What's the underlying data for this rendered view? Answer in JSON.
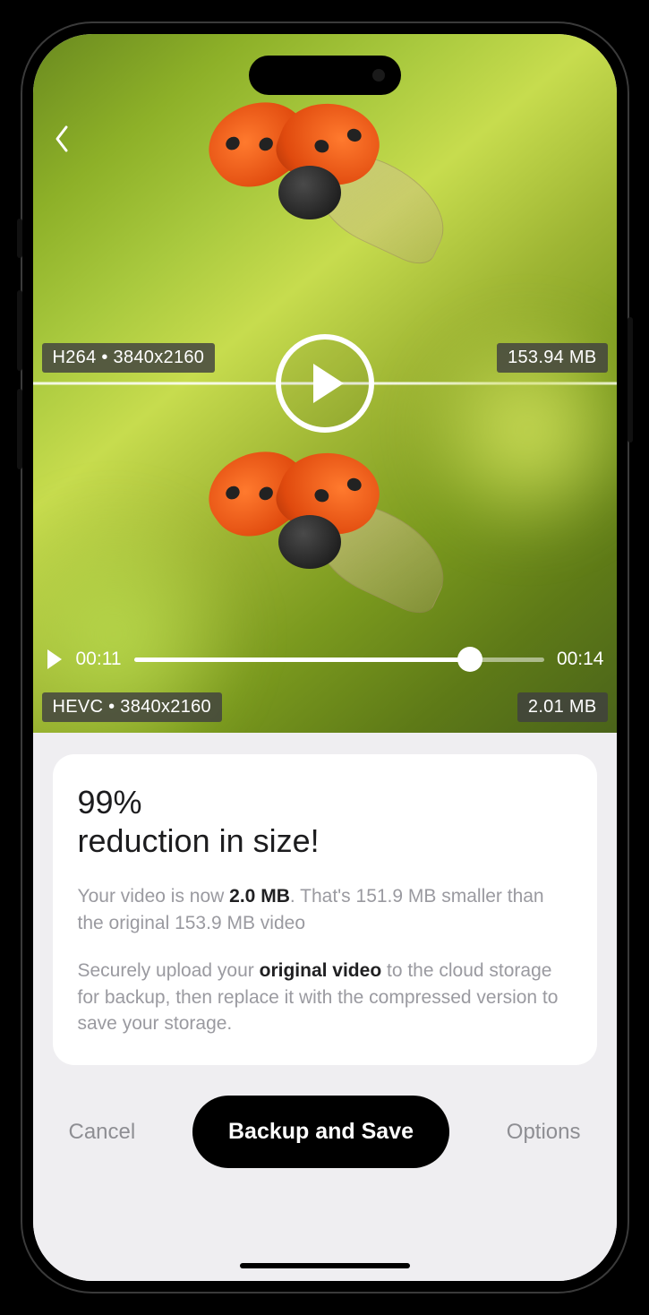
{
  "video": {
    "original": {
      "codec_resolution": "H264  •  3840x2160",
      "size": "153.94 MB"
    },
    "compressed": {
      "codec_resolution": "HEVC  •  3840x2160",
      "size": "2.01 MB"
    },
    "playback": {
      "current": "00:11",
      "total": "00:14"
    }
  },
  "result": {
    "headline_l1": "99%",
    "headline_l2": "reduction in size!",
    "p1_a": "Your video is now ",
    "p1_bold": "2.0 MB",
    "p1_b": ". That's 151.9 MB smaller than the original 153.9 MB video",
    "p2_a": "Securely upload your ",
    "p2_bold": "original video",
    "p2_b": " to the cloud storage for backup, then replace it with the compressed version to save your storage."
  },
  "actions": {
    "cancel": "Cancel",
    "primary": "Backup and Save",
    "options": "Options"
  }
}
